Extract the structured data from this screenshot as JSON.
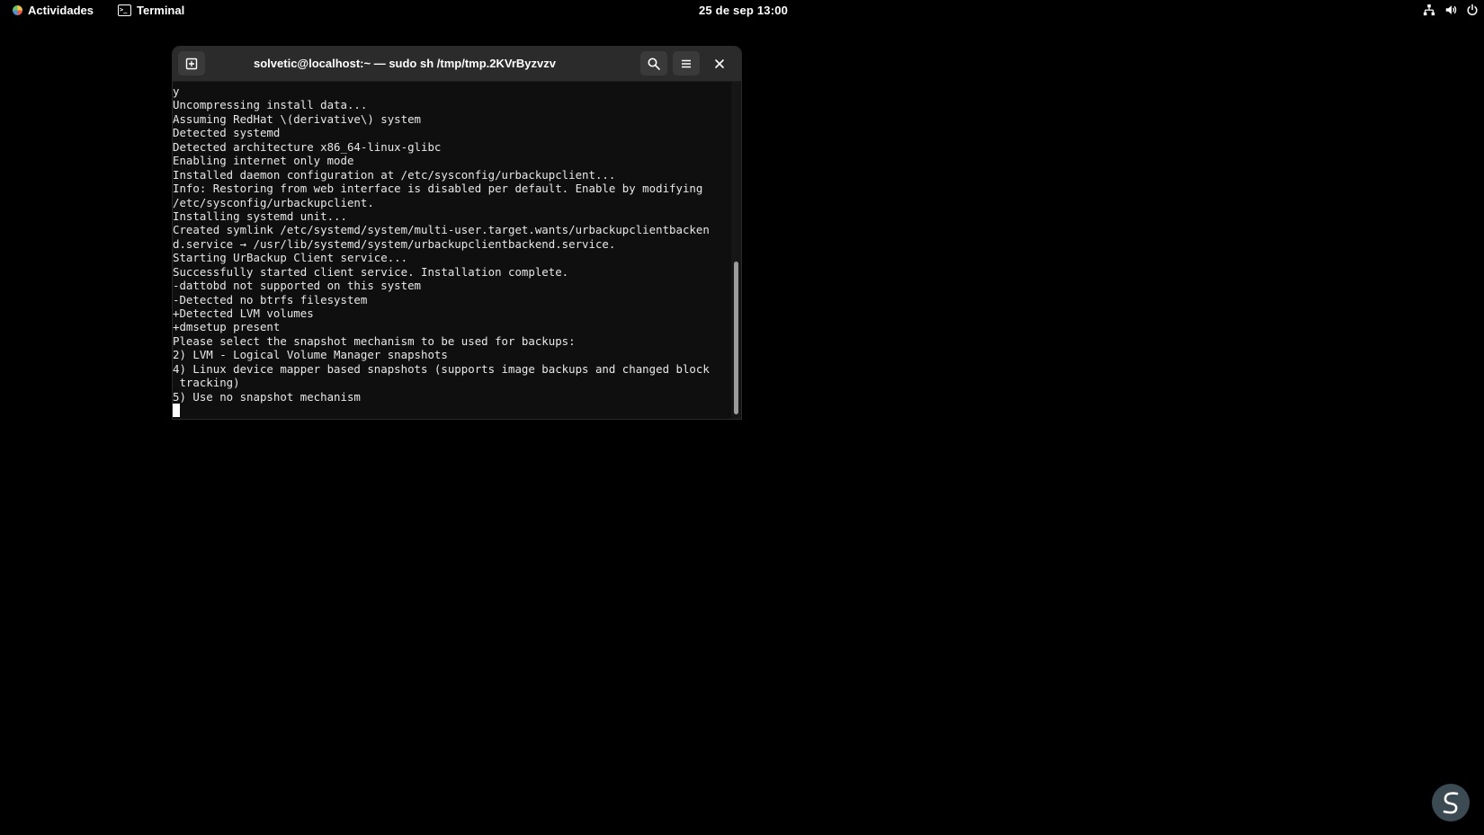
{
  "topbar": {
    "activities_label": "Actividades",
    "activities_icon": "gnome-foot-icon",
    "app_label": "Terminal",
    "app_icon": "terminal-icon",
    "clock": "25 de sep  13:00",
    "tray_icons": [
      "network-icon",
      "volume-icon",
      "power-icon"
    ]
  },
  "window": {
    "title": "solvetic@localhost:~ — sudo sh /tmp/tmp.2KVrByzvzv",
    "buttons": {
      "new_tab_icon": "new-tab-icon",
      "search_icon": "search-icon",
      "menu_icon": "hamburger-menu-icon",
      "close_icon": "close-icon"
    },
    "terminal_lines": [
      "y",
      "Uncompressing install data...",
      "Assuming RedHat \\(derivative\\) system",
      "Detected systemd",
      "Detected architecture x86_64-linux-glibc",
      "Enabling internet only mode",
      "Installed daemon configuration at /etc/sysconfig/urbackupclient...",
      "Info: Restoring from web interface is disabled per default. Enable by modifying",
      "/etc/sysconfig/urbackupclient.",
      "Installing systemd unit...",
      "Created symlink /etc/systemd/system/multi-user.target.wants/urbackupclientbacken",
      "d.service → /usr/lib/systemd/system/urbackupclientbackend.service.",
      "Starting UrBackup Client service...",
      "Successfully started client service. Installation complete.",
      "-dattobd not supported on this system",
      "-Detected no btrfs filesystem",
      "+Detected LVM volumes",
      "+dmsetup present",
      "Please select the snapshot mechanism to be used for backups:",
      "2) LVM - Logical Volume Manager snapshots",
      "4) Linux device mapper based snapshots (supports image backups and changed block",
      " tracking)",
      "5) Use no snapshot mechanism"
    ],
    "prompt_input": ""
  },
  "watermark": {
    "icon": "solvetic-logo-icon"
  },
  "colors": {
    "desktop_bg": "#000000",
    "headerbar_bg": "#2b2b2b",
    "terminal_bg": "#0f0f0f",
    "terminal_fg": "#e8e8e8"
  }
}
